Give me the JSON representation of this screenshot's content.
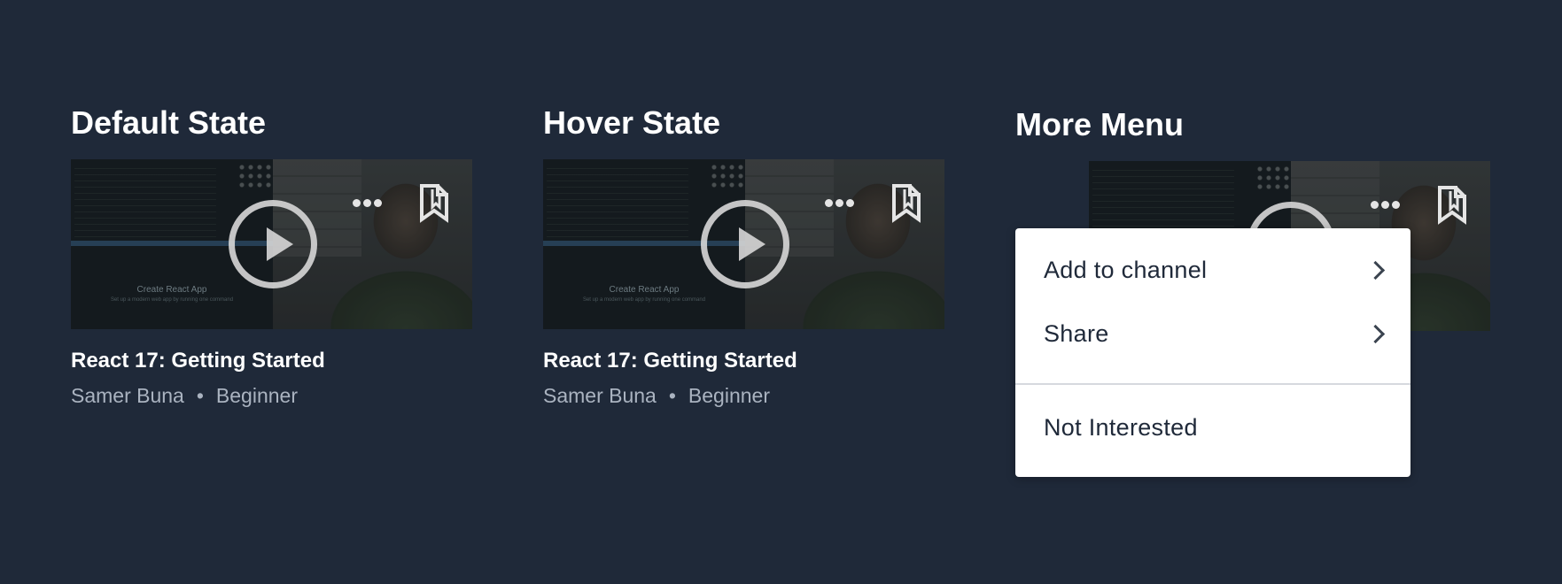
{
  "sections": {
    "default": {
      "heading": "Default State"
    },
    "hover": {
      "heading": "Hover State"
    },
    "menu": {
      "heading": "More Menu"
    }
  },
  "course": {
    "title": "React 17: Getting Started",
    "author": "Samer Buna",
    "separator": "•",
    "level": "Beginner",
    "thumbnail_screen_title": "Create React App",
    "thumbnail_screen_subtitle": "Set up a modern web app by running one command"
  },
  "icons": {
    "play": "play-icon",
    "more": "more-dots-icon",
    "bookmark": "bookmark-icon",
    "chevron": "chevron-right-icon"
  },
  "more_menu": {
    "items": [
      {
        "label": "Add to channel",
        "has_submenu": true
      },
      {
        "label": "Share",
        "has_submenu": true
      },
      {
        "label": "Not Interested",
        "has_submenu": false
      }
    ]
  },
  "colors": {
    "background": "#1f2939",
    "heading": "#ffffff",
    "meta_text": "#aab3c0",
    "menu_bg": "#ffffff",
    "menu_text": "#1f2939"
  }
}
